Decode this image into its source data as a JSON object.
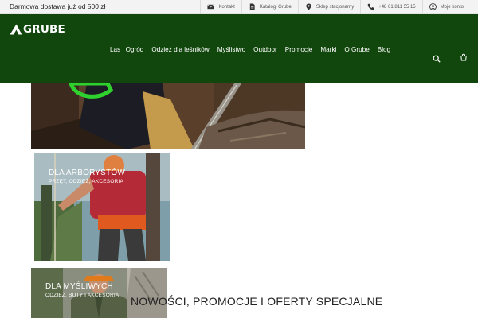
{
  "topbar": {
    "promo": "Darmowa dostawa już od 500 zł",
    "links": [
      {
        "icon": "envelope-icon",
        "label": "Kontakt"
      },
      {
        "icon": "catalog-icon",
        "label": "Katalogi Grube"
      },
      {
        "icon": "map-pin-icon",
        "label": "Sklep stacjonarny"
      },
      {
        "icon": "phone-icon",
        "label": "+48 61 811 55 15"
      },
      {
        "icon": "user-icon",
        "label": "Moje konto"
      }
    ]
  },
  "header": {
    "logo": "GRUBE",
    "nav": [
      "Las i Ogród",
      "Odzież dla leśników",
      "Myślistwo",
      "Outdoor",
      "Promocje",
      "Marki",
      "O Grube",
      "Blog"
    ],
    "icons": [
      "search-icon",
      "cart-icon"
    ]
  },
  "tiles": [
    {
      "title": "",
      "subtitle": ""
    },
    {
      "title": "DLA ARBORYSTÓW",
      "subtitle": "PRZĘT, ODZIEŻ, AKCESORIA"
    },
    {
      "title": "DLA MYŚLIWYCH",
      "subtitle": "ODZIEŻ, BUTY I AKCESORIA"
    }
  ],
  "section": {
    "title": "NOWOŚCI, PROMOCJE I OFERTY SPECJALNE"
  },
  "colors": {
    "header_bg": "#11470d",
    "topbar_bg": "#f3f3f3",
    "accent_green": "#2fd12f"
  }
}
